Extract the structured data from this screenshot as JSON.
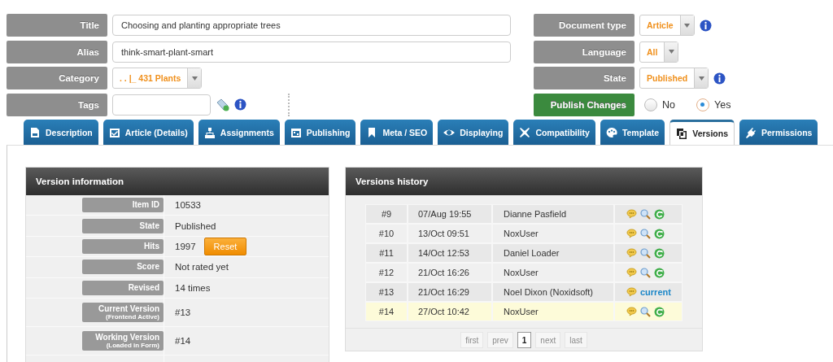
{
  "form_left": [
    {
      "label": "Title",
      "kind": "text",
      "value": "Choosing and planting appropriate trees"
    },
    {
      "label": "Alias",
      "kind": "text",
      "value": "think-smart-plant-smart"
    },
    {
      "label": "Category",
      "kind": "select",
      "value": ". . |_ 431 Plants"
    },
    {
      "label": "Tags",
      "kind": "tags"
    }
  ],
  "form_right": [
    {
      "label": "Document type",
      "kind": "select",
      "value": "Article",
      "info": true
    },
    {
      "label": "Language",
      "kind": "select",
      "value": "All",
      "info": false
    },
    {
      "label": "State",
      "kind": "select",
      "value": "Published",
      "info": true
    },
    {
      "label": "Publish Changes",
      "kind": "radio",
      "options": [
        {
          "label": "No",
          "selected": false
        },
        {
          "label": "Yes",
          "selected": true
        }
      ]
    }
  ],
  "tabs": [
    {
      "label": "Description",
      "selected": false
    },
    {
      "label": "Article (Details)",
      "selected": false
    },
    {
      "label": "Assignments",
      "selected": false
    },
    {
      "label": "Publishing",
      "selected": false
    },
    {
      "label": "Meta / SEO",
      "selected": false
    },
    {
      "label": "Displaying",
      "selected": false
    },
    {
      "label": "Compatibility",
      "selected": false
    },
    {
      "label": "Template",
      "selected": false
    },
    {
      "label": "Versions",
      "selected": true
    },
    {
      "label": "Permissions",
      "selected": false
    }
  ],
  "version_info": {
    "title": "Version information",
    "rows": [
      {
        "label": "Item ID",
        "value": "10533"
      },
      {
        "label": "State",
        "value": "Published"
      },
      {
        "label": "Hits",
        "value": "1997",
        "button": "Reset"
      },
      {
        "label": "Score",
        "value": "Not rated yet"
      },
      {
        "label": "Revised",
        "value": "14 times"
      },
      {
        "label": "Current Version",
        "sublabel": "(Frontend Active)",
        "value": "#13"
      },
      {
        "label": "Working Version",
        "sublabel": "(Loaded in Form)",
        "value": "#14"
      }
    ]
  },
  "versions_history": {
    "title": "Versions history",
    "rows": [
      {
        "number": "#9",
        "date": "07/Aug 19:55",
        "author": "Dianne Pasfield",
        "kind": "icons",
        "selected": false
      },
      {
        "number": "#10",
        "date": "13/Oct 09:51",
        "author": "NoxUser",
        "kind": "icons",
        "selected": false
      },
      {
        "number": "#11",
        "date": "14/Oct 12:53",
        "author": "Daniel Loader",
        "kind": "icons",
        "selected": false
      },
      {
        "number": "#12",
        "date": "21/Oct 16:26",
        "author": "NoxUser",
        "kind": "icons",
        "selected": false
      },
      {
        "number": "#13",
        "date": "21/Oct 16:29",
        "author": "Noel Dixon (Noxidsoft)",
        "kind": "current",
        "current": "current",
        "selected": false
      },
      {
        "number": "#14",
        "date": "27/Oct 10:42",
        "author": "NoxUser",
        "kind": "icons",
        "selected": true
      }
    ],
    "pagination": [
      {
        "label": "first",
        "disabled": true,
        "selected": false
      },
      {
        "label": "prev",
        "disabled": true,
        "selected": false
      },
      {
        "label": "1",
        "disabled": false,
        "selected": true
      },
      {
        "label": "next",
        "disabled": true,
        "selected": false
      },
      {
        "label": "last",
        "disabled": true,
        "selected": false
      }
    ]
  }
}
